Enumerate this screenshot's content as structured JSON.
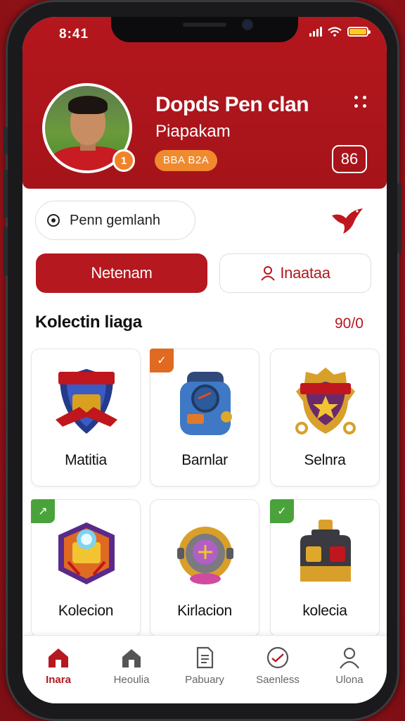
{
  "status_bar": {
    "time": "8:41"
  },
  "profile": {
    "name": "Dopds Pen clan",
    "subtitle": "Piapakam",
    "badge": "BBA B2A",
    "avatar_badge": "1",
    "score_button": "86"
  },
  "search": {
    "label": "Penn gemlanh"
  },
  "tabs": [
    {
      "label": "Netenam",
      "active": true
    },
    {
      "label": "Inaataa",
      "active": false
    }
  ],
  "collection": {
    "title": "Kolectin liaga",
    "count": "90/0",
    "items": [
      {
        "label": "Matitia",
        "icon": "shield-emblem-icon",
        "tag": null
      },
      {
        "label": "Barnlar",
        "icon": "blue-device-icon",
        "tag": "orange-check"
      },
      {
        "label": "Selnra",
        "icon": "star-crest-icon",
        "tag": null
      },
      {
        "label": "Kolecion",
        "icon": "glowing-chest-icon",
        "tag": "green-arrow"
      },
      {
        "label": "Kirlacion",
        "icon": "gear-orb-icon",
        "tag": null
      },
      {
        "label": "kolecia",
        "icon": "dark-chest-icon",
        "tag": "green-check"
      }
    ]
  },
  "bottom_nav": [
    {
      "label": "Inara",
      "icon": "home-icon",
      "active": true
    },
    {
      "label": "Heoulia",
      "icon": "house-outline-icon",
      "active": false
    },
    {
      "label": "Pabuary",
      "icon": "document-icon",
      "active": false
    },
    {
      "label": "Saenless",
      "icon": "chart-circle-icon",
      "active": false
    },
    {
      "label": "Ulona",
      "icon": "user-icon",
      "active": false
    }
  ],
  "colors": {
    "primary": "#b5181e",
    "accent": "#f08a2e",
    "tag_green": "#4aa33a"
  }
}
